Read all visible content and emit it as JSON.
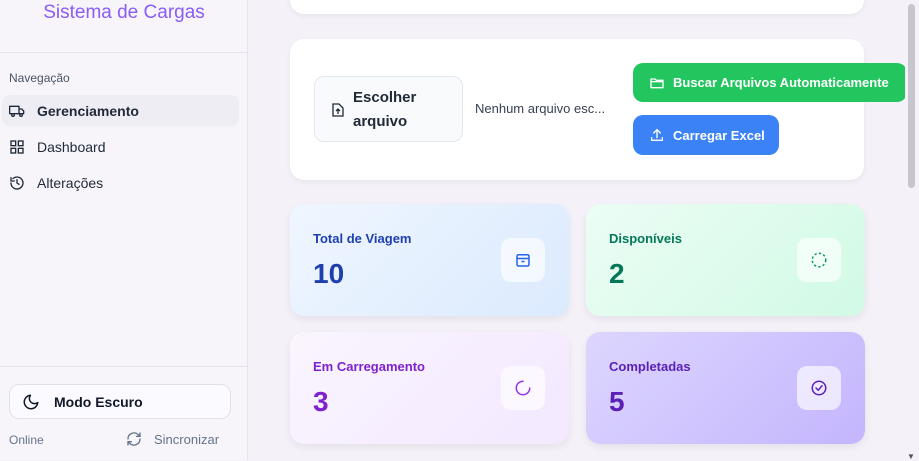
{
  "brand": {
    "title": "Sistema de Cargas"
  },
  "sidebar": {
    "section_label": "Navegação",
    "items": [
      {
        "label": "Gerenciamento",
        "icon": "truck-icon",
        "active": true
      },
      {
        "label": "Dashboard",
        "icon": "grid-icon",
        "active": false
      },
      {
        "label": "Alterações",
        "icon": "history-icon",
        "active": false
      }
    ],
    "dark_mode_label": "Modo Escuro",
    "status_text": "Online",
    "sync_label": "Sincronizar"
  },
  "upload": {
    "choose_label": "Escolher arquivo",
    "no_file_text": "Nenhum arquivo esc...",
    "auto_fetch_label": "Buscar Arquivos Automaticamente",
    "upload_excel_label": "Carregar Excel"
  },
  "stats": [
    {
      "title": "Total de Viagem",
      "value": "10",
      "color": "#1e40af",
      "icon": "package-icon"
    },
    {
      "title": "Disponíveis",
      "value": "2",
      "color": "#047857",
      "icon": "dashed-circle-icon"
    },
    {
      "title": "Em Carregamento",
      "value": "3",
      "color": "#7e22ce",
      "icon": "loader-icon"
    },
    {
      "title": "Completadas",
      "value": "5",
      "color": "#5b21b6",
      "icon": "check-circle-icon"
    }
  ],
  "colors": {
    "accent": "#8b5cf6",
    "green": "#22c55e",
    "blue": "#3b82f6"
  }
}
